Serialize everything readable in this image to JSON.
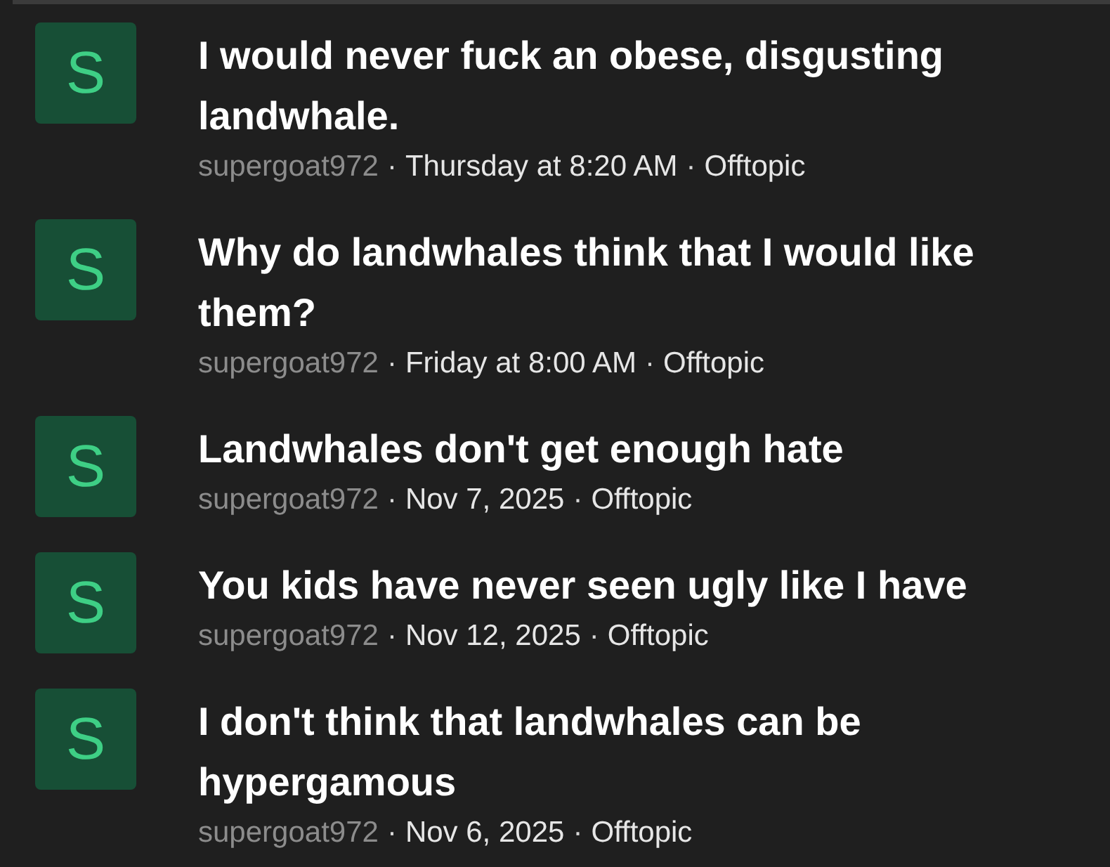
{
  "results": [
    {
      "avatar": "S",
      "title": "I would never fuck an obese, disgusting landwhale.",
      "meta": [
        {
          "kind": "author",
          "text": "supergoat972"
        },
        {
          "kind": "separator",
          "text": "·"
        },
        {
          "kind": "date",
          "text": "Thursday at 8:20 AM"
        },
        {
          "kind": "separator",
          "text": "·"
        },
        {
          "kind": "forum",
          "text": "Offtopic"
        }
      ]
    },
    {
      "avatar": "S",
      "title": "Why do landwhales think that I would like them?",
      "meta": [
        {
          "kind": "author",
          "text": "supergoat972"
        },
        {
          "kind": "separator",
          "text": "·"
        },
        {
          "kind": "date",
          "text": "Friday at 8:00 AM"
        },
        {
          "kind": "separator",
          "text": "·"
        },
        {
          "kind": "forum",
          "text": "Offtopic"
        }
      ]
    },
    {
      "avatar": "S",
      "title": "Landwhales don't get enough hate",
      "meta": [
        {
          "kind": "author",
          "text": "supergoat972"
        },
        {
          "kind": "separator",
          "text": "·"
        },
        {
          "kind": "date",
          "text": "Nov 7, 2025"
        },
        {
          "kind": "separator",
          "text": "·"
        },
        {
          "kind": "forum",
          "text": "Offtopic"
        }
      ]
    },
    {
      "avatar": "S",
      "title": "You kids have never seen ugly like I have",
      "meta": [
        {
          "kind": "author",
          "text": "supergoat972"
        },
        {
          "kind": "separator",
          "text": "·"
        },
        {
          "kind": "date",
          "text": "Nov 12, 2025"
        },
        {
          "kind": "separator",
          "text": "·"
        },
        {
          "kind": "forum",
          "text": "Offtopic"
        }
      ]
    },
    {
      "avatar": "S",
      "title": "I don't think that landwhales can be hypergamous",
      "meta": [
        {
          "kind": "author",
          "text": "supergoat972"
        },
        {
          "kind": "separator",
          "text": "·"
        },
        {
          "kind": "date",
          "text": "Nov 6, 2025"
        },
        {
          "kind": "separator",
          "text": "·"
        },
        {
          "kind": "forum",
          "text": "Offtopic"
        }
      ]
    }
  ]
}
